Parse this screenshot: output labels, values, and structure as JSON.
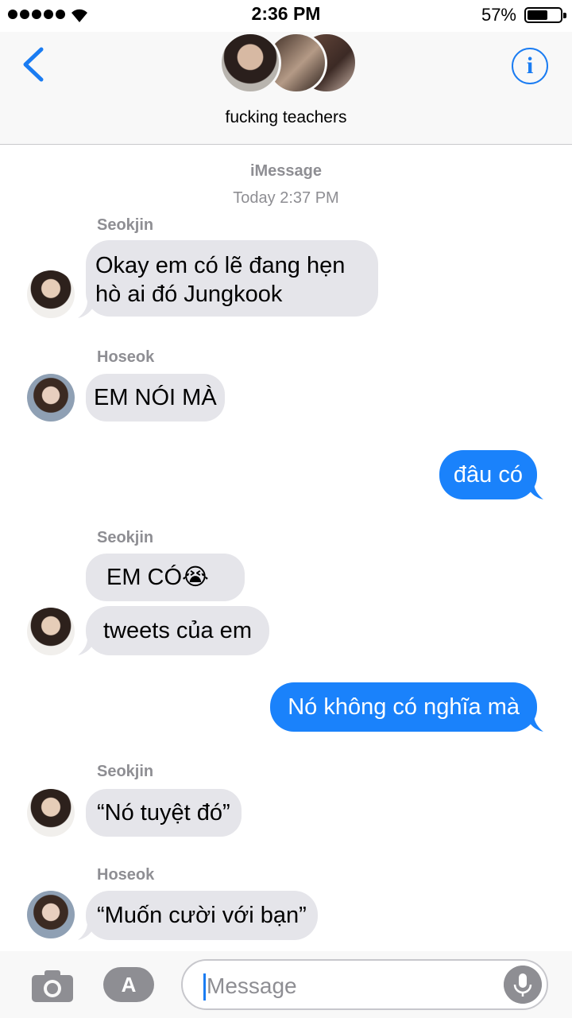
{
  "status_bar": {
    "time": "2:36 PM",
    "battery_percent_label": "57%",
    "battery_level": 0.57,
    "signal_bars": 5
  },
  "header": {
    "back_icon": "chevron-left-icon",
    "group_title": "fucking teachers",
    "info_icon": "info-icon",
    "info_glyph": "i",
    "avatar_count": 3
  },
  "conversation": {
    "service": "iMessage",
    "timestamp": "Today 2:37 PM",
    "messages": [
      {
        "sender": "Seokjin",
        "text": "Okay em có lẽ đang hẹn hò ai đó Jungkook",
        "direction": "in"
      },
      {
        "sender": "Hoseok",
        "text": "EM NÓI MÀ",
        "direction": "in"
      },
      {
        "sender": "",
        "text": "đâu có",
        "direction": "out"
      },
      {
        "sender": "Seokjin",
        "text": "EM CÓ😭",
        "direction": "in"
      },
      {
        "sender": "",
        "text": "tweets của em",
        "direction": "in"
      },
      {
        "sender": "",
        "text": "Nó không có nghĩa mà",
        "direction": "out"
      },
      {
        "sender": "Seokjin",
        "text": "“Nó tuyệt đó”",
        "direction": "in"
      },
      {
        "sender": "Hoseok",
        "text": "“Muốn cười với bạn”",
        "direction": "in"
      }
    ]
  },
  "input_bar": {
    "camera_icon": "camera-icon",
    "appstore_icon": "app-store-icon",
    "placeholder": "Message",
    "mic_icon": "microphone-icon"
  },
  "colors": {
    "accent": "#1a7cf2",
    "outgoing_bubble": "#1a82fb",
    "incoming_bubble": "#e5e5ea",
    "secondary_text": "#8e8e93"
  }
}
